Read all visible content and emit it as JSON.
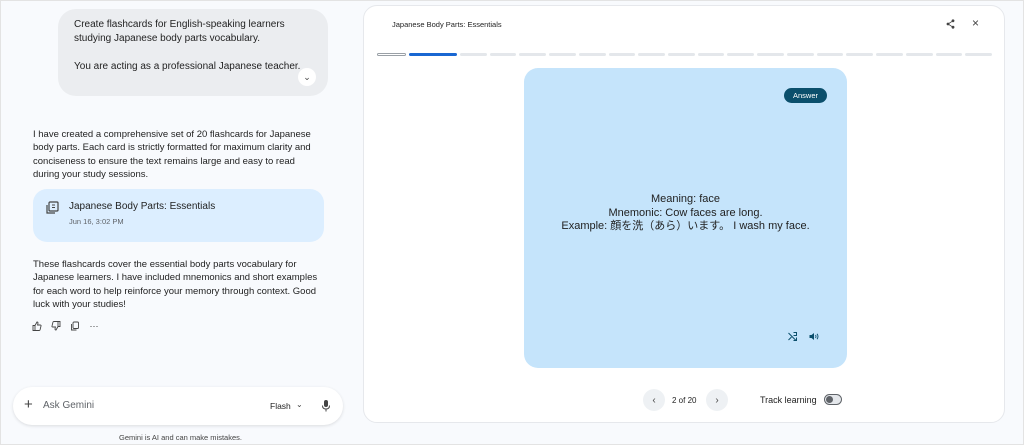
{
  "chat": {
    "user_prompt": {
      "line1": "Create flashcards for English-speaking learners studying Japanese body parts vocabulary.",
      "line2": "You are acting as a professional Japanese teacher."
    },
    "response_intro": "I have created a comprehensive set of 20 flashcards for Japanese body parts. Each card is strictly formatted for maximum clarity and conciseness to ensure the text remains large and easy to read during your study sessions.",
    "artifact": {
      "title": "Japanese Body Parts: Essentials",
      "date": "Jun 16, 3:02 PM"
    },
    "response_outro": "These flashcards cover the essential body parts vocabulary for Japanese learners. I have included mnemonics and short examples for each word to help reinforce your memory through context. Good luck with your studies!",
    "input": {
      "placeholder": "Ask Gemini",
      "model": "Flash"
    },
    "disclaimer": "Gemini is AI and can make mistakes."
  },
  "canvas": {
    "title": "Japanese Body Parts: Essentials",
    "progress": {
      "total": 20,
      "current": 2
    },
    "card": {
      "badge": "Answer",
      "meaning": "Meaning: face",
      "mnemonic": "Mnemonic: Cow faces are long.",
      "example": "Example: 顔を洗（あら）います。 I wash my face."
    },
    "counter": "2 of 20",
    "track_label": "Track learning",
    "track_enabled": false
  },
  "colors": {
    "card_bg": "#c5e4fb",
    "badge_bg": "#0b4f6c",
    "progress_active": "#1967d2",
    "chip_bg": "#dceeff"
  }
}
